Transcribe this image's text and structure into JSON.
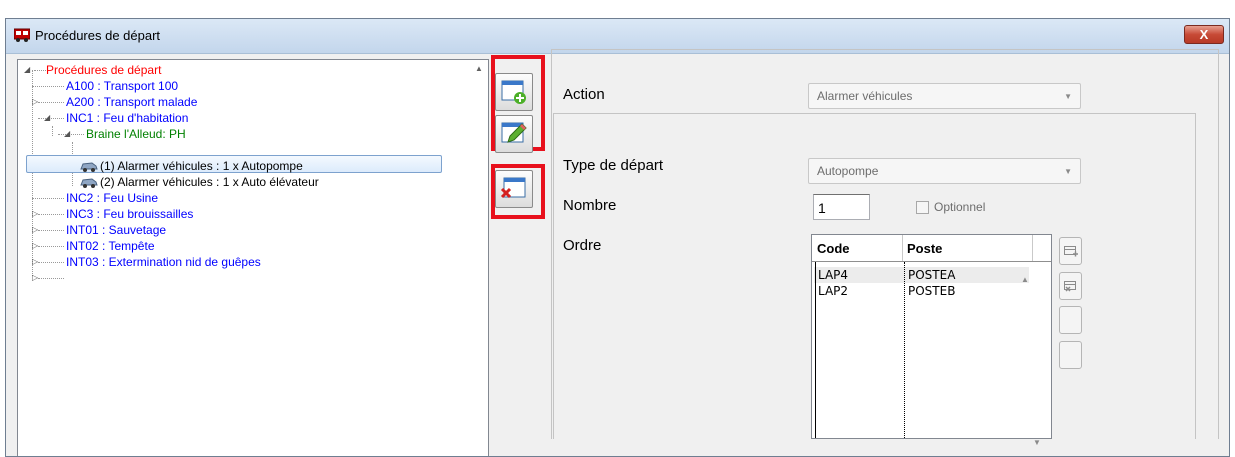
{
  "window": {
    "title": "Procédures de départ",
    "close_label": "X"
  },
  "tree": {
    "root": "Procédures de départ",
    "items": [
      {
        "label": "A100 : Transport 100"
      },
      {
        "label": "A200 : Transport malade"
      },
      {
        "label": "INC1 : Feu d'habitation"
      },
      {
        "label": "Braine l'Alleud: PH"
      },
      {
        "label": "(1) Alarmer véhicules : 1 x Autopompe"
      },
      {
        "label": "(2) Alarmer véhicules : 1 x Auto élévateur"
      },
      {
        "label": "INC2 : Feu  Usine"
      },
      {
        "label": "INC3 : Feu brouissailles"
      },
      {
        "label": "INT01 : Sauvetage"
      },
      {
        "label": "INT02 : Tempête"
      },
      {
        "label": "INT03 : Extermination nid de guêpes"
      }
    ]
  },
  "form": {
    "action_label": "Action",
    "action_value": "Alarmer véhicules",
    "type_label": "Type de départ",
    "type_value": "Autopompe",
    "nombre_label": "Nombre",
    "nombre_value": "1",
    "optionnel_label": "Optionnel",
    "ordre_label": "Ordre"
  },
  "grid": {
    "columns": [
      "Code",
      "Poste"
    ],
    "rows": [
      {
        "code": "LAP4",
        "poste": "POSTEA"
      },
      {
        "code": "LAP2",
        "poste": "POSTEB"
      }
    ]
  },
  "colors": {
    "root": "#ff0000",
    "procedure": "#0000ff",
    "location": "#008000",
    "highlight": "#e8101c"
  }
}
